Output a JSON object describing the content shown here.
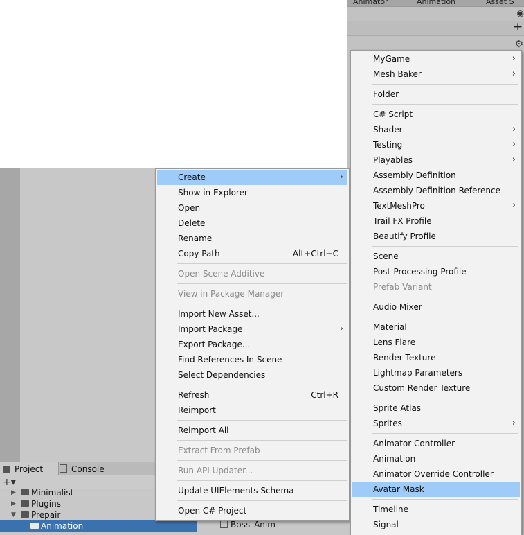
{
  "top_tabs": [
    "Animator",
    "Animation",
    "Asset S"
  ],
  "context_menu": {
    "items": [
      {
        "label": "Create",
        "submenu": true,
        "highlighted": true
      },
      {
        "label": "Show in Explorer"
      },
      {
        "label": "Open"
      },
      {
        "label": "Delete"
      },
      {
        "label": "Rename"
      },
      {
        "label": "Copy Path",
        "shortcut": "Alt+Ctrl+C"
      },
      {
        "sep": true
      },
      {
        "label": "Open Scene Additive",
        "disabled": true
      },
      {
        "sep": true
      },
      {
        "label": "View in Package Manager",
        "disabled": true
      },
      {
        "sep": true
      },
      {
        "label": "Import New Asset..."
      },
      {
        "label": "Import Package",
        "submenu": true
      },
      {
        "label": "Export Package..."
      },
      {
        "label": "Find References In Scene"
      },
      {
        "label": "Select Dependencies"
      },
      {
        "sep": true
      },
      {
        "label": "Refresh",
        "shortcut": "Ctrl+R"
      },
      {
        "label": "Reimport"
      },
      {
        "sep": true
      },
      {
        "label": "Reimport All"
      },
      {
        "sep": true
      },
      {
        "label": "Extract From Prefab",
        "disabled": true
      },
      {
        "sep": true
      },
      {
        "label": "Run API Updater...",
        "disabled": true
      },
      {
        "sep": true
      },
      {
        "label": "Update UIElements Schema"
      },
      {
        "sep": true
      },
      {
        "label": "Open C# Project"
      }
    ]
  },
  "create_submenu": {
    "items": [
      {
        "label": "MyGame",
        "submenu": true
      },
      {
        "label": "Mesh Baker",
        "submenu": true
      },
      {
        "sep": true
      },
      {
        "label": "Folder"
      },
      {
        "sep": true
      },
      {
        "label": "C# Script"
      },
      {
        "label": "Shader",
        "submenu": true
      },
      {
        "label": "Testing",
        "submenu": true
      },
      {
        "label": "Playables",
        "submenu": true
      },
      {
        "label": "Assembly Definition"
      },
      {
        "label": "Assembly Definition Reference"
      },
      {
        "label": "TextMeshPro",
        "submenu": true
      },
      {
        "label": "Trail FX Profile"
      },
      {
        "label": "Beautify Profile"
      },
      {
        "sep": true
      },
      {
        "label": "Scene"
      },
      {
        "label": "Post-Processing Profile"
      },
      {
        "label": "Prefab Variant",
        "disabled": true
      },
      {
        "sep": true
      },
      {
        "label": "Audio Mixer"
      },
      {
        "sep": true
      },
      {
        "label": "Material"
      },
      {
        "label": "Lens Flare"
      },
      {
        "label": "Render Texture"
      },
      {
        "label": "Lightmap Parameters"
      },
      {
        "label": "Custom Render Texture"
      },
      {
        "sep": true
      },
      {
        "label": "Sprite Atlas"
      },
      {
        "label": "Sprites",
        "submenu": true
      },
      {
        "sep": true
      },
      {
        "label": "Animator Controller"
      },
      {
        "label": "Animation"
      },
      {
        "label": "Animator Override Controller"
      },
      {
        "label": "Avatar Mask",
        "highlighted": true
      },
      {
        "sep": true
      },
      {
        "label": "Timeline"
      },
      {
        "label": "Signal"
      }
    ]
  },
  "project_panel": {
    "tabs": [
      {
        "label": "Project",
        "icon": "folder-icon"
      },
      {
        "label": "Console",
        "icon": "console-icon"
      }
    ],
    "add_button": "+▾",
    "tree": [
      {
        "label": "Minimalist",
        "expanded": false
      },
      {
        "label": "Plugins",
        "expanded": false
      },
      {
        "label": "Prepair",
        "expanded": true
      },
      {
        "label": "Animation",
        "selected": true
      }
    ],
    "assets": [
      "Boss_Anim"
    ]
  },
  "colors": {
    "menu_bg": "#f2f2f2",
    "highlight": "#9ecbf7",
    "selection": "#3a72b0",
    "disabled_text": "#8a8a8a"
  }
}
